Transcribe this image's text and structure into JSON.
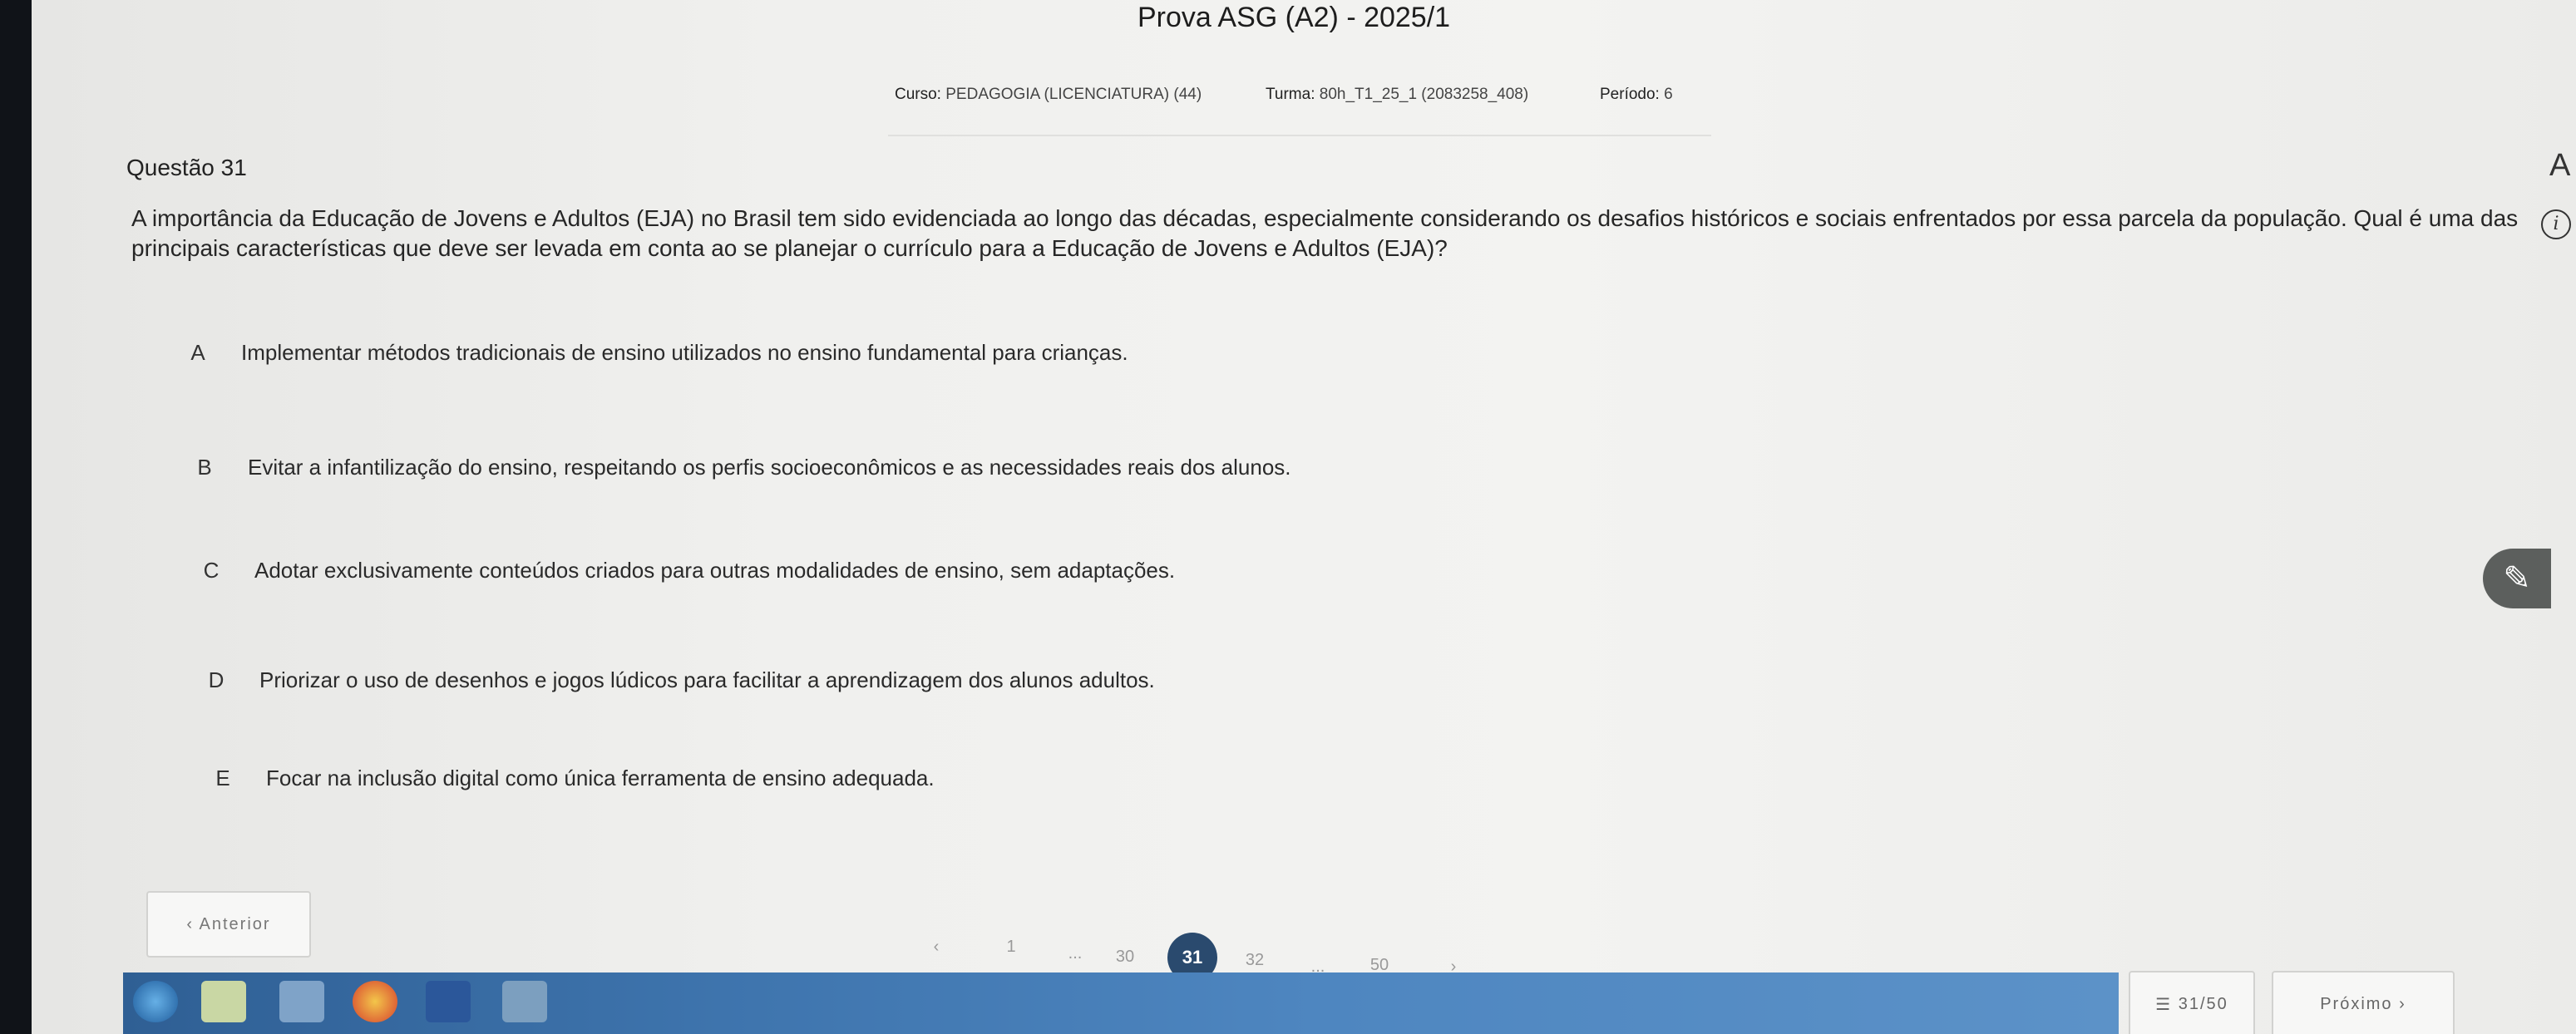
{
  "header": {
    "title": "Prova ASG (A2) - 2025/1",
    "course_label": "Curso:",
    "course_value": "PEDAGOGIA (LICENCIATURA) (44)",
    "class_label": "Turma:",
    "class_value": "80h_T1_25_1 (2083258_408)",
    "period_label": "Período:",
    "period_value": "6"
  },
  "question": {
    "number_label": "Questão 31",
    "stem": "A importância da Educação de Jovens e Adultos (EJA) no Brasil tem sido evidenciada ao longo das décadas, especialmente considerando os desafios históricos e sociais enfrentados por essa parcela da população. Qual é uma das principais características que deve ser levada em conta ao se planejar o currículo para a Educação de Jovens e Adultos (EJA)?",
    "options": [
      {
        "letter": "A",
        "text": "Implementar métodos tradicionais de ensino utilizados no ensino fundamental para crianças."
      },
      {
        "letter": "B",
        "text": "Evitar a infantilização do ensino, respeitando os perfis socioeconômicos e as necessidades reais dos alunos."
      },
      {
        "letter": "C",
        "text": "Adotar exclusivamente conteúdos criados para outras modalidades de ensino, sem adaptações."
      },
      {
        "letter": "D",
        "text": "Priorizar o uso de desenhos e jogos lúdicos para facilitar a aprendizagem dos alunos adultos."
      },
      {
        "letter": "E",
        "text": "Focar na inclusão digital como única ferramenta de ensino adequada."
      }
    ]
  },
  "icons": {
    "font_size": "A",
    "info": "i",
    "pen": "✎"
  },
  "navigation": {
    "prev_label": "‹  Anterior",
    "next_label": "Próximo  ›",
    "counter_label": "31/50",
    "counter_icon": "☰",
    "pages": [
      "‹",
      "1",
      "...",
      "30",
      "31",
      "32",
      "...",
      "50",
      "›"
    ],
    "current_page": "31"
  },
  "colors": {
    "accent": "#2a4a6e",
    "taskbar": "#3e74ad"
  }
}
